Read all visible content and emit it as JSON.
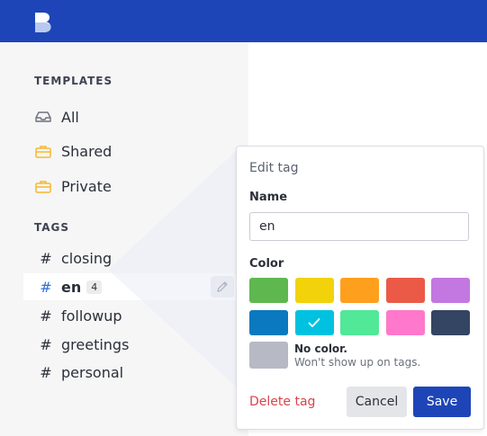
{
  "sidebar": {
    "templates_title": "TEMPLATES",
    "templates": [
      {
        "label": "All",
        "icon": "inbox-icon"
      },
      {
        "label": "Shared",
        "icon": "briefcase-icon"
      },
      {
        "label": "Private",
        "icon": "briefcase-icon"
      }
    ],
    "tags_title": "TAGS",
    "tags": [
      {
        "label": "closing",
        "count": "",
        "active": false
      },
      {
        "label": "en",
        "count": "4",
        "active": true
      },
      {
        "label": "followup",
        "count": "",
        "active": false
      },
      {
        "label": "greetings",
        "count": "",
        "active": false
      },
      {
        "label": "personal",
        "count": "",
        "active": false
      }
    ],
    "hash": "#"
  },
  "popover": {
    "title": "Edit tag",
    "name_label": "Name",
    "name_value": "en",
    "color_label": "Color",
    "colors": [
      "#5fb84f",
      "#f2d20a",
      "#ff9f1e",
      "#eb5a46",
      "#c377e0",
      "#0a79bf",
      "#00c2e0",
      "#51e898",
      "#ff78cb",
      "#344563"
    ],
    "selected_color": "#00c2e0",
    "no_color_title": "No color.",
    "no_color_sub": "Won't show up on tags.",
    "delete_label": "Delete tag",
    "cancel_label": "Cancel",
    "save_label": "Save"
  },
  "theme": {
    "topbar": "#1e45b7",
    "accent": "#1e45b7",
    "danger": "#d9434a",
    "folder_icon": "#f5b82e"
  }
}
